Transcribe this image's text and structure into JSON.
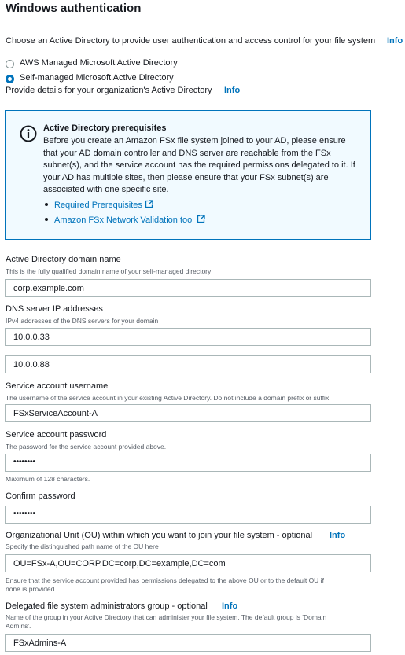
{
  "section_title": "Windows authentication",
  "intro": {
    "text": "Choose an Active Directory to provide user authentication and access control for your file system",
    "info": "Info"
  },
  "radios": [
    {
      "label": "AWS Managed Microsoft Active Directory",
      "selected": false
    },
    {
      "label": "Self-managed Microsoft Active Directory",
      "selected": true
    }
  ],
  "details": {
    "text": "Provide details for your organization's Active Directory",
    "info": "Info"
  },
  "alert": {
    "icon": "info-circle-icon",
    "title": "Active Directory prerequisites",
    "body": "Before you create an Amazon FSx file system joined to your AD, please ensure that your AD domain controller and DNS server are reachable from the FSx subnet(s), and the service account has the required permissions delegated to it. If your AD has multiple sites, then please ensure that your FSx subnet(s) are associated with one specific site.",
    "links": [
      "Required Prerequisites",
      "Amazon FSx Network Validation tool"
    ]
  },
  "fields": {
    "domain": {
      "label": "Active Directory domain name",
      "desc": "This is the fully qualified domain name of your self-managed directory",
      "value": "corp.example.com"
    },
    "dns": {
      "label": "DNS server IP addresses",
      "desc": "IPv4 addresses of the DNS servers for your domain",
      "values": [
        "10.0.0.33",
        "10.0.0.88"
      ]
    },
    "username": {
      "label": "Service account username",
      "desc": "The username of the service account in your existing Active Directory. Do not include a domain prefix or suffix.",
      "value": "FSxServiceAccount-A"
    },
    "password": {
      "label": "Service account password",
      "desc": "The password for the service account provided above.",
      "value": "••••••••",
      "hint": "Maximum of 128 characters."
    },
    "confirm": {
      "label": "Confirm password",
      "value": "••••••••"
    },
    "ou": {
      "label": "Organizational Unit (OU) within which you want to join your file system - optional",
      "info": "Info",
      "desc": "Specify the distinguished path name of the OU here",
      "value": "OU=FSx-A,OU=CORP,DC=corp,DC=example,DC=com",
      "hint_line1": "Ensure that the service account provided has permissions delegated to the above OU or to the default OU if",
      "hint_line2": "none is provided."
    },
    "admins": {
      "label": "Delegated file system administrators group - optional",
      "info": "Info",
      "desc_line1": "Name of the group in your Active Directory that can administer your file system. The default group is 'Domain",
      "desc_line2": "Admins'.",
      "value": "FSxAdmins-A"
    }
  }
}
